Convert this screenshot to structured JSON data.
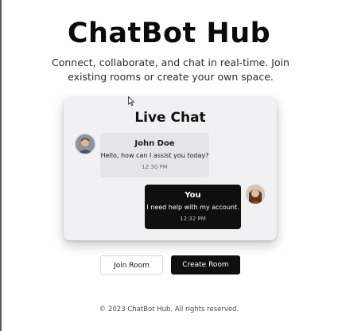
{
  "header": {
    "title": "ChatBot Hub",
    "subtitle": "Connect, collaborate, and chat in real-time. Join existing rooms or create your own space."
  },
  "chat": {
    "title": "Live Chat",
    "messages": [
      {
        "sender": "John Doe",
        "text": "Hello, how can I assist you today?",
        "time": "12:30 PM"
      },
      {
        "sender": "You",
        "text": "I need help with my account.",
        "time": "12:32 PM"
      }
    ]
  },
  "actions": {
    "join_label": "Join Room",
    "create_label": "Create Room"
  },
  "footer": {
    "text": "© 2023 ChatBot Hub. All rights reserved."
  },
  "colors": {
    "primary": "#0f0f10",
    "card_background": "#f1f1f3",
    "bot_bubble": "#e3e5e8"
  },
  "icons": {
    "cursor": "mouse-pointer-icon"
  }
}
